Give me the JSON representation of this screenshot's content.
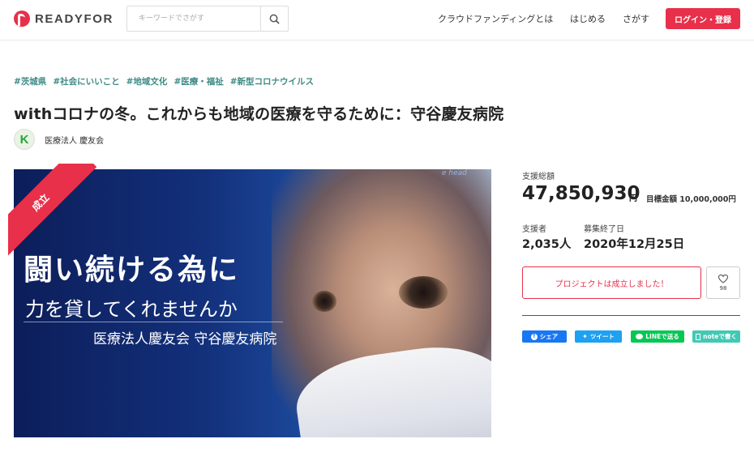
{
  "header": {
    "logo_text": "READYFOR",
    "search_placeholder": "キーワードでさがす",
    "nav": [
      "クラウドファンディングとは",
      "はじめる",
      "さがす"
    ],
    "login_label": "ログイン・登録"
  },
  "project": {
    "tags": [
      "#茨城県",
      "#社会にいいこと",
      "#地域文化",
      "#医療・福祉",
      "#新型コロナウイルス"
    ],
    "title": "withコロナの冬。これからも地域の医療を守るために：守谷慶友病院",
    "owner_initial": "K",
    "owner_name": "医療法人 慶友会"
  },
  "hero": {
    "ribbon": "成立",
    "line1": "闘い続ける為に",
    "line2": "力を貸してくれませんか",
    "line3": "医療法人慶友会 守谷慶友病院",
    "corner_text": "e head"
  },
  "stats": {
    "total_label": "支援総額",
    "total_amount": "47,850,930",
    "currency": "円",
    "target_text": "目標金額 10,000,000円",
    "supporters_label": "支援者",
    "supporters_value": "2,035人",
    "end_label": "募集終了日",
    "end_value": "2020年12月25日",
    "status_label": "プロジェクトは成立しました！",
    "favorite_count": "98"
  },
  "share": {
    "facebook": "シェア",
    "twitter": "ツイート",
    "line": "LINEで送る",
    "note": "noteで書く"
  },
  "colors": {
    "brand": "#e8304a",
    "tag": "#3e8b86",
    "facebook": "#1877f2",
    "twitter": "#1da1f2",
    "line": "#06c755",
    "note": "#41c9b4"
  }
}
